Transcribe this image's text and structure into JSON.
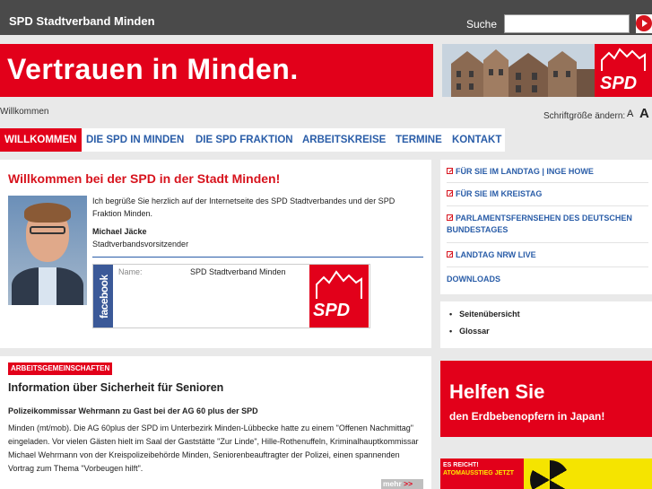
{
  "header": {
    "site_title": "SPD Stadtverband Minden",
    "search_label": "Suche",
    "search_placeholder": ""
  },
  "banner": {
    "slogan": "Vertrauen in Minden.",
    "logo_text": "SPD"
  },
  "breadcrumb": "Willkommen",
  "font_size": {
    "label": "Schriftgröße ändern:",
    "small": "A",
    "large": "A"
  },
  "nav": [
    {
      "label": "WILLKOMMEN",
      "active": true
    },
    {
      "label": "DIE SPD IN MINDEN",
      "active": false
    },
    {
      "label": "DIE SPD FRAKTION",
      "active": false
    },
    {
      "label": "ARBEITSKREISE",
      "active": false
    },
    {
      "label": "TERMINE",
      "active": false
    },
    {
      "label": "KONTAKT",
      "active": false
    }
  ],
  "welcome": {
    "title": "Willkommen bei der SPD in der Stadt Minden!",
    "intro": "Ich begrüße Sie herzlich auf der Internetseite des SPD Stadtverbandes und der SPD Fraktion Minden.",
    "author_name": "Michael Jäcke",
    "author_role": "Stadtverbandsvorsitzender"
  },
  "facebook": {
    "strip_text": "facebook",
    "name_label": "Name:",
    "name_value": "SPD Stadtverband Minden",
    "logo_text": "SPD"
  },
  "article": {
    "tag": "ARBEITSGEMEINSCHAFTEN",
    "title": "Information über Sicherheit für Senioren",
    "subtitle": "Polizeikommissar Wehrmann zu Gast bei der AG 60 plus der SPD",
    "body": "Minden (mt/mob). Die AG 60plus der SPD im Unterbezirk Minden-Lübbecke hatte zu einem \"Offenen Nachmittag\" eingeladen. Vor vielen Gästen hielt im Saal der Gaststätte \"Zur Linde\", Hille-Rothenuffeln, Kriminalhauptkommissar Michael Wehrmann von der Kreispolizeibehörde Minden, Seniorenbeauftragter der Polizei, einen spannenden Vortrag zum Thema \"Vorbeugen hilft\".",
    "more_label": "mehr",
    "more_arrow": ">>"
  },
  "sidebar": {
    "links": [
      "FÜR SIE IM LANDTAG | INGE HOWE",
      "FÜR SIE IM KREISTAG",
      "PARLAMENTSFERNSEHEN DES DEUTSCHEN BUNDESTAGES",
      "LANDTAG NRW LIVE",
      "DOWNLOADS"
    ],
    "meta": [
      "Seitenübersicht",
      "Glossar"
    ]
  },
  "japan_banner": {
    "line1": "Helfen Sie",
    "line2": "den Erdbebenopfern in Japan!"
  },
  "atom_banner": {
    "line1": "ES REICHT!",
    "line2": "ATOMAUSSTIEG JETZT"
  },
  "colors": {
    "spd_red": "#e2001a",
    "link_blue": "#2a5da8",
    "topbar": "#4a4a4a",
    "facebook_blue": "#3b5998"
  }
}
